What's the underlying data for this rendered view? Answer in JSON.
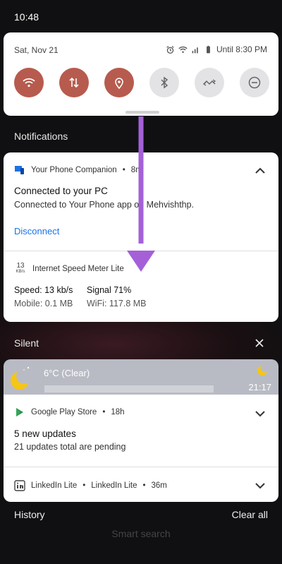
{
  "status_bar": {
    "time": "10:48"
  },
  "quick_settings": {
    "date": "Sat, Nov 21",
    "alarm_label": "Until 8:30 PM",
    "tiles": [
      {
        "name": "wifi-icon",
        "state": "on"
      },
      {
        "name": "mobile-data-icon",
        "state": "on"
      },
      {
        "name": "location-icon",
        "state": "on"
      },
      {
        "name": "bluetooth-icon",
        "state": "off"
      },
      {
        "name": "data-saver-icon",
        "state": "off"
      },
      {
        "name": "do-not-disturb-icon",
        "state": "off"
      }
    ],
    "accent_color": "#b75b4e"
  },
  "notifications_header": "Notifications",
  "phone_companion": {
    "app": "Your Phone Companion",
    "time": "8m",
    "title": "Connected to your PC",
    "body": "Connected to Your Phone app on Mehvishthp.",
    "action": "Disconnect"
  },
  "speed_meter": {
    "icon_value": "13",
    "icon_unit": "KB/s",
    "app": "Internet Speed Meter Lite",
    "speed": "Speed: 13 kb/s",
    "signal": "Signal 71%",
    "mobile": "Mobile: 0.1 MB",
    "wifi": "WiFi: 117.8 MB"
  },
  "silent_header": "Silent",
  "weather": {
    "temp": "6°C (Clear)",
    "time": "21:17"
  },
  "play_store": {
    "app": "Google Play Store",
    "time": "18h",
    "title": "5 new updates",
    "body": "21 updates total are pending"
  },
  "linkedin": {
    "app": "LinkedIn Lite",
    "sub": "LinkedIn Lite",
    "time": "36m"
  },
  "footer": {
    "history": "History",
    "clear_all": "Clear all",
    "smart_search": "Smart search"
  }
}
